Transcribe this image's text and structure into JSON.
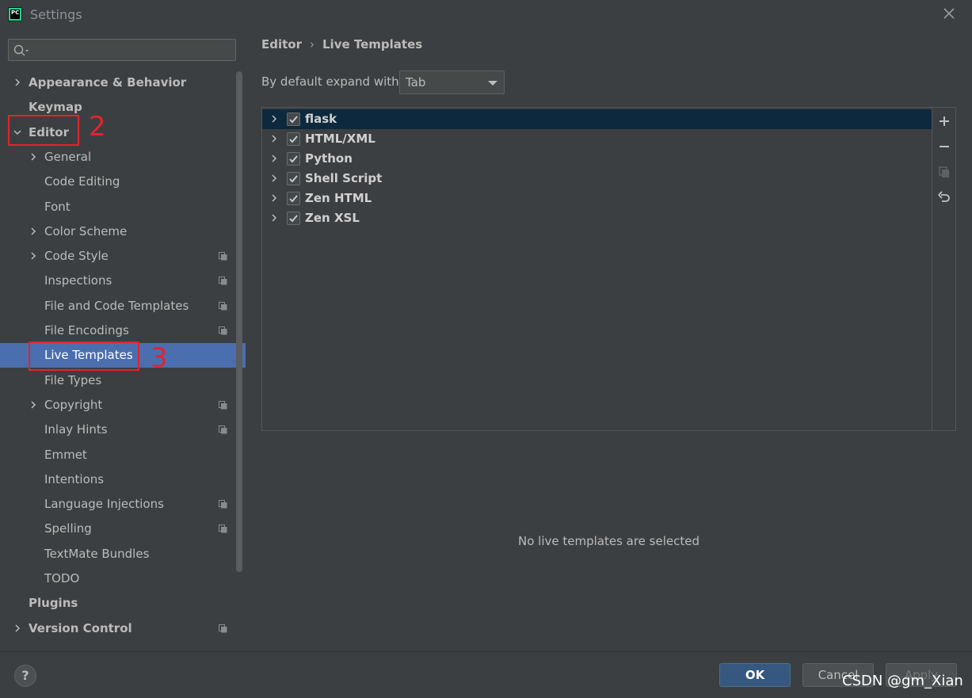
{
  "window": {
    "title": "Settings"
  },
  "search": {
    "placeholder": ""
  },
  "sidebar": {
    "items": [
      {
        "label": "Appearance & Behavior",
        "level": 0,
        "expandable": true,
        "expanded": false,
        "bold": true,
        "shared": false
      },
      {
        "label": "Keymap",
        "level": 0,
        "expandable": false,
        "bold": true,
        "shared": false
      },
      {
        "label": "Editor",
        "level": 0,
        "expandable": true,
        "expanded": true,
        "bold": true,
        "shared": false
      },
      {
        "label": "General",
        "level": 1,
        "expandable": true,
        "expanded": false,
        "bold": false,
        "shared": false
      },
      {
        "label": "Code Editing",
        "level": 1,
        "expandable": false,
        "bold": false,
        "shared": false
      },
      {
        "label": "Font",
        "level": 1,
        "expandable": false,
        "bold": false,
        "shared": false
      },
      {
        "label": "Color Scheme",
        "level": 1,
        "expandable": true,
        "expanded": false,
        "bold": false,
        "shared": false
      },
      {
        "label": "Code Style",
        "level": 1,
        "expandable": true,
        "expanded": false,
        "bold": false,
        "shared": true
      },
      {
        "label": "Inspections",
        "level": 1,
        "expandable": false,
        "bold": false,
        "shared": true
      },
      {
        "label": "File and Code Templates",
        "level": 1,
        "expandable": false,
        "bold": false,
        "shared": true
      },
      {
        "label": "File Encodings",
        "level": 1,
        "expandable": false,
        "bold": false,
        "shared": true
      },
      {
        "label": "Live Templates",
        "level": 1,
        "expandable": false,
        "bold": false,
        "shared": false,
        "selected": true
      },
      {
        "label": "File Types",
        "level": 1,
        "expandable": false,
        "bold": false,
        "shared": false
      },
      {
        "label": "Copyright",
        "level": 1,
        "expandable": true,
        "expanded": false,
        "bold": false,
        "shared": true
      },
      {
        "label": "Inlay Hints",
        "level": 1,
        "expandable": false,
        "bold": false,
        "shared": true
      },
      {
        "label": "Emmet",
        "level": 1,
        "expandable": false,
        "bold": false,
        "shared": false
      },
      {
        "label": "Intentions",
        "level": 1,
        "expandable": false,
        "bold": false,
        "shared": false
      },
      {
        "label": "Language Injections",
        "level": 1,
        "expandable": false,
        "bold": false,
        "shared": true
      },
      {
        "label": "Spelling",
        "level": 1,
        "expandable": false,
        "bold": false,
        "shared": true
      },
      {
        "label": "TextMate Bundles",
        "level": 1,
        "expandable": false,
        "bold": false,
        "shared": false
      },
      {
        "label": "TODO",
        "level": 1,
        "expandable": false,
        "bold": false,
        "shared": false
      },
      {
        "label": "Plugins",
        "level": 0,
        "expandable": false,
        "bold": true,
        "shared": false
      },
      {
        "label": "Version Control",
        "level": 0,
        "expandable": true,
        "expanded": false,
        "bold": true,
        "shared": true
      }
    ]
  },
  "annotations": [
    {
      "label": "2",
      "target": "Editor"
    },
    {
      "label": "3",
      "target": "Live Templates"
    }
  ],
  "main": {
    "breadcrumb": [
      "Editor",
      "Live Templates"
    ],
    "expand_label": "By default expand with",
    "expand_value": "Tab",
    "template_groups": [
      {
        "name": "flask",
        "checked": true,
        "selected": true
      },
      {
        "name": "HTML/XML",
        "checked": true,
        "selected": false
      },
      {
        "name": "Python",
        "checked": true,
        "selected": false
      },
      {
        "name": "Shell Script",
        "checked": true,
        "selected": false
      },
      {
        "name": "Zen HTML",
        "checked": true,
        "selected": false
      },
      {
        "name": "Zen XSL",
        "checked": true,
        "selected": false
      }
    ],
    "tools": [
      "plus-icon",
      "minus-icon",
      "copy-icon",
      "undo-icon"
    ],
    "empty_message": "No live templates are selected"
  },
  "footer": {
    "help_label": "?",
    "ok_label": "OK",
    "cancel_label": "Cancel",
    "apply_label": "Apply",
    "watermark": "CSDN @gm_Xian"
  },
  "colors": {
    "background": "#3c3f41",
    "selection": "#4b6eaf",
    "list_selection": "#0d293e",
    "ok_button": "#365880",
    "annotation": "#e0242f"
  }
}
